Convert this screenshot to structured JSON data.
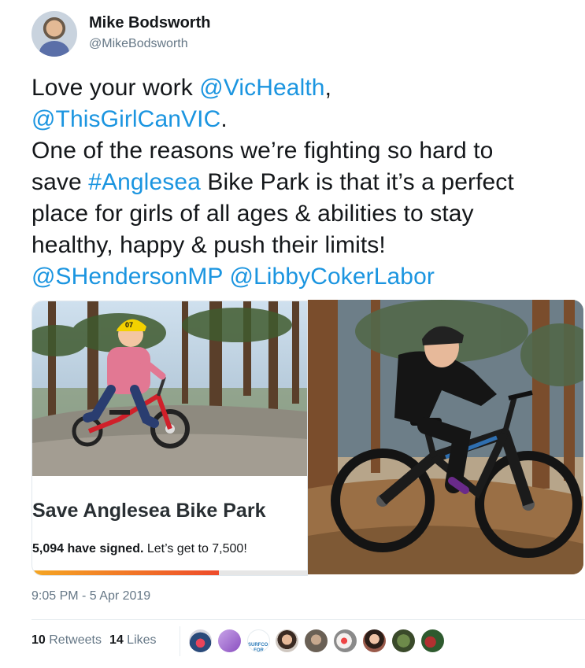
{
  "tweet": {
    "author": {
      "name": "Mike Bodsworth",
      "handle": "@MikeBodsworth"
    },
    "text_lines": [
      [
        {
          "t": "Love your work "
        },
        {
          "t": "@VicHealth",
          "link": true
        },
        {
          "t": ","
        }
      ],
      [
        {
          "t": "@ThisGirlCanVIC",
          "link": true
        },
        {
          "t": "."
        }
      ],
      [
        {
          "t": "One of the reasons we’re fighting so hard to"
        }
      ],
      [
        {
          "t": "save "
        },
        {
          "t": "#Anglesea",
          "link": true
        },
        {
          "t": " Bike Park is that it’s a perfect"
        }
      ],
      [
        {
          "t": "place for girls of all ages & abilities to stay"
        }
      ],
      [
        {
          "t": "healthy, happy  & push their limits!"
        }
      ],
      [
        {
          "t": "@SHendersonMP",
          "link": true
        },
        {
          "t": " "
        },
        {
          "t": "@LibbyCokerLabor",
          "link": true
        }
      ]
    ],
    "card": {
      "title": "Save Anglesea Bike Park",
      "signed_count": "5,094 have signed.",
      "goal_text": " Let’s get to 7,500!",
      "progress": 0.68
    },
    "helmet_number": "07",
    "timestamp": "9:05 PM - 5 Apr 2019",
    "stats": {
      "retweets_count": "10",
      "retweets_label": " Retweets",
      "likes_count": "14",
      "likes_label": " Likes"
    },
    "likers_badge_text": "SURFCOAST FOR ACTION"
  },
  "colors": {
    "link": "#1b95e0",
    "progress_start": "#f5a623",
    "progress_end": "#ee4b2b"
  }
}
